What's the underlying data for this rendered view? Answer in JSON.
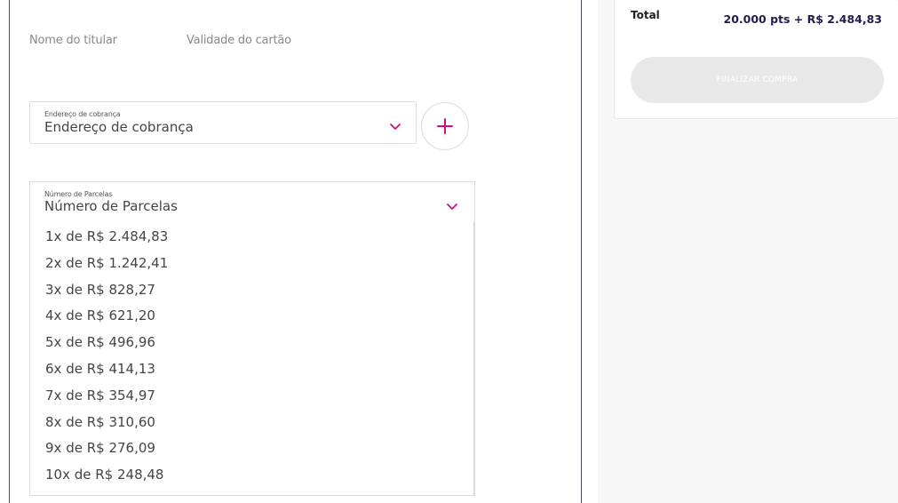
{
  "form": {
    "holder_name_label": "Nome do titular",
    "expiry_label": "Validade do cartão",
    "billing": {
      "small_label": "Endereço de cobrança",
      "value": "Endereço de cobrança",
      "chevron_icon": "chevron-down-icon",
      "add_icon": "plus-icon"
    },
    "installments": {
      "small_label": "Número de Parcelas",
      "value": "Número de Parcelas",
      "chevron_icon": "chevron-down-icon",
      "options": [
        "1x de R$ 2.484,83",
        "2x de R$ 1.242,41",
        "3x de R$ 828,27",
        "4x de R$ 621,20",
        "5x de R$ 496,96",
        "6x de R$ 414,13",
        "7x de R$ 354,97",
        "8x de R$ 310,60",
        "9x de R$ 276,09",
        "10x de R$ 248,48"
      ]
    }
  },
  "summary": {
    "total_label": "Total",
    "total_value": "20.000 pts + R$ 2.484,83",
    "finalize_label": "FINALIZAR COMPRA"
  },
  "colors": {
    "accent": "#c8127a",
    "total_value": "#1d1d4f",
    "button_disabled": "#e8e8e8"
  }
}
